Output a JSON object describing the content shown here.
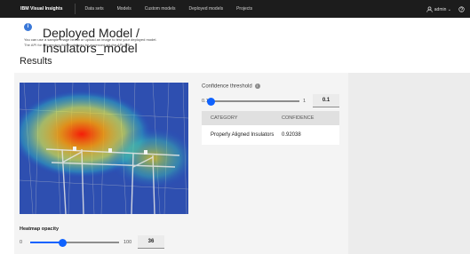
{
  "header": {
    "brand": "IBM Visual Insights",
    "nav": [
      "Data sets",
      "Models",
      "Custom models",
      "Deployed models",
      "Projects"
    ],
    "user": "admin"
  },
  "page": {
    "breadcrumb_line1": "Deployed Model /",
    "breadcrumb_line2": "Insulators_model",
    "note_line1": "You can use a sample image below or upload an image to test your deployed model.",
    "note_line2": "The API for inferencing this model can be accessed via the API URL.",
    "results_title": "Results"
  },
  "threshold": {
    "label": "Confidence threshold",
    "min_label": "0.1",
    "max_label": "1",
    "value": "0.1",
    "fraction": 0.0
  },
  "table": {
    "headers": [
      "CATEGORY",
      "CONFIDENCE"
    ],
    "rows": [
      {
        "category": "Properly Aligned Insulators",
        "confidence": "0.92038"
      }
    ]
  },
  "opacity": {
    "label": "Heatmap opacity",
    "min_label": "0",
    "max_label": "100",
    "value": "36",
    "fraction": 0.36
  }
}
